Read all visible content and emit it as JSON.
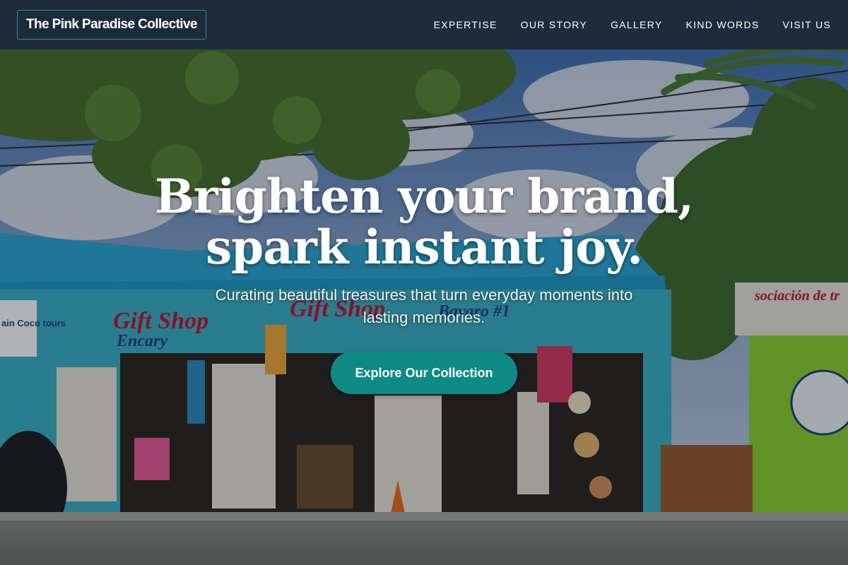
{
  "header": {
    "brand": "The Pink Paradise Collective",
    "nav": [
      {
        "label": "EXPERTISE"
      },
      {
        "label": "OUR STORY"
      },
      {
        "label": "GALLERY"
      },
      {
        "label": "KIND WORDS"
      },
      {
        "label": "VISIT US"
      }
    ]
  },
  "hero": {
    "headline_line1": "Brighten your brand,",
    "headline_line2": "spark instant joy.",
    "subtext": "Curating beautiful treasures that turn everyday moments into lasting memories.",
    "cta_label": "Explore Our Collection",
    "image_signs": {
      "shop_sign_left": "Gift Shop",
      "shop_sign_left_sub": "Encary",
      "shop_sign_center": "Gift Shop",
      "shop_sign_center_sub": "Bavaro #1",
      "side_sign": "ain Coco tours",
      "right_sign": "sociación de tr"
    }
  },
  "colors": {
    "header_bg": "#1f2b3b",
    "accent": "#0e8a85",
    "text": "#ffffff"
  }
}
